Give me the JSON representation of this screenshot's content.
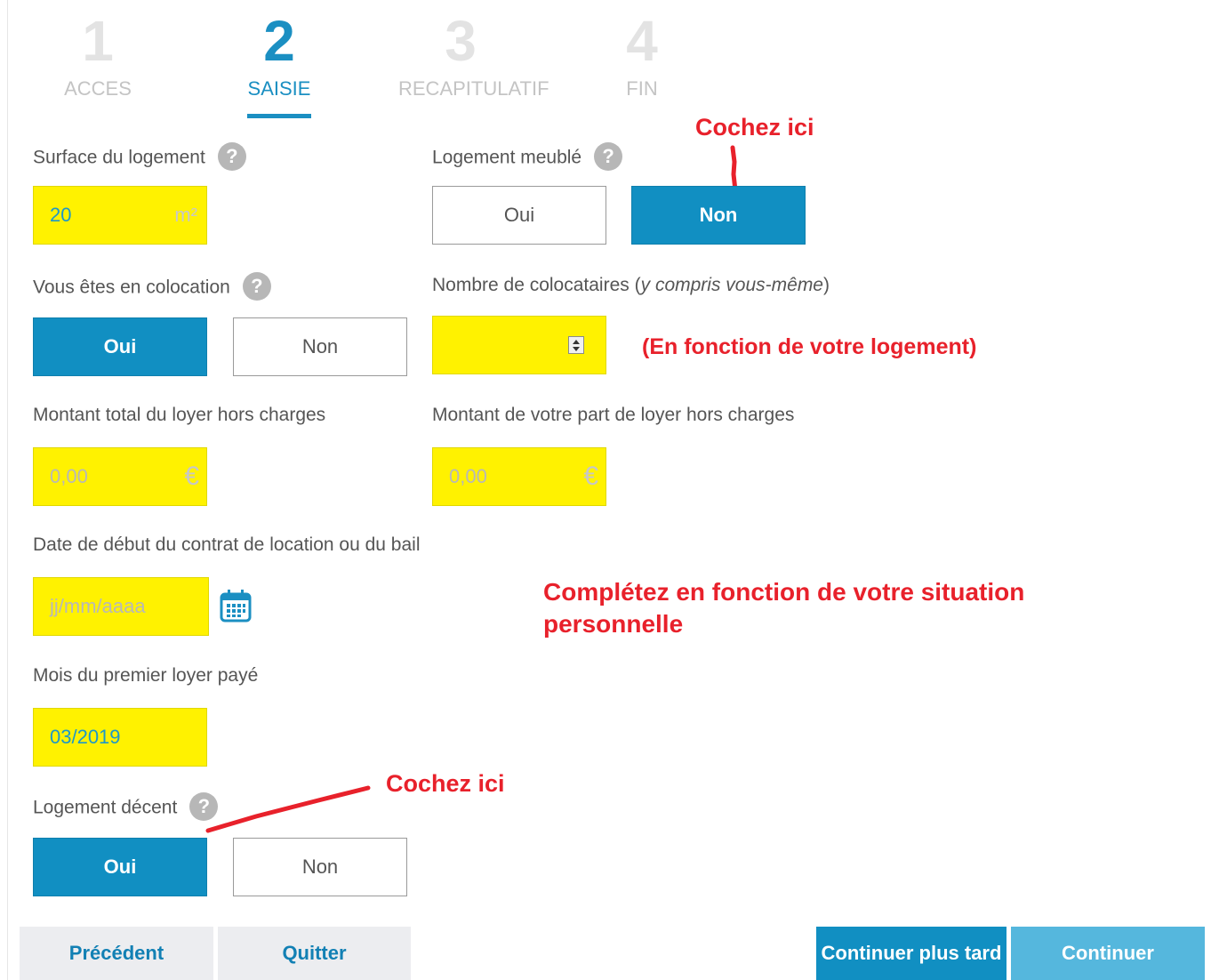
{
  "steps": [
    {
      "num": "1",
      "label": "ACCES"
    },
    {
      "num": "2",
      "label": "SAISIE"
    },
    {
      "num": "3",
      "label": "RECAPITULATIF"
    },
    {
      "num": "4",
      "label": "FIN"
    }
  ],
  "surface": {
    "label": "Surface du logement",
    "value": "20",
    "unit": "m²"
  },
  "meuble": {
    "label": "Logement meublé",
    "oui": "Oui",
    "non": "Non",
    "selected": "Non"
  },
  "colocation": {
    "label": "Vous êtes en colocation",
    "oui": "Oui",
    "non": "Non",
    "selected": "Oui"
  },
  "nb_colocataires": {
    "label": "Nombre de colocataires (",
    "label_em": "y compris vous-même",
    "label_end": ")",
    "value": ""
  },
  "loyer_total": {
    "label": "Montant total du loyer hors charges",
    "value": "0,00",
    "currency": "€"
  },
  "loyer_part": {
    "label": "Montant de votre part de loyer hors charges",
    "value": "0,00",
    "currency": "€"
  },
  "date_debut": {
    "label": "Date de début du contrat de location ou du bail",
    "placeholder": "jj/mm/aaaa"
  },
  "premier_loyer": {
    "label": "Mois du premier loyer payé",
    "value": "03/2019"
  },
  "decent": {
    "label": "Logement décent",
    "oui": "Oui",
    "non": "Non",
    "selected": "Oui"
  },
  "footer": {
    "precedent": "Précédent",
    "quitter": "Quitter",
    "plus_tard": "Continuer plus tard",
    "continuer": "Continuer"
  },
  "annotations": {
    "cochez_1": "Cochez ici",
    "en_fonction": "(En fonction de votre logement)",
    "completez_1": "Complétez en fonction de votre situation",
    "completez_2": "personnelle",
    "cochez_2": "Cochez ici"
  },
  "colors": {
    "accent": "#118fc2",
    "highlight": "#fff200",
    "annotation": "#e8212b"
  }
}
